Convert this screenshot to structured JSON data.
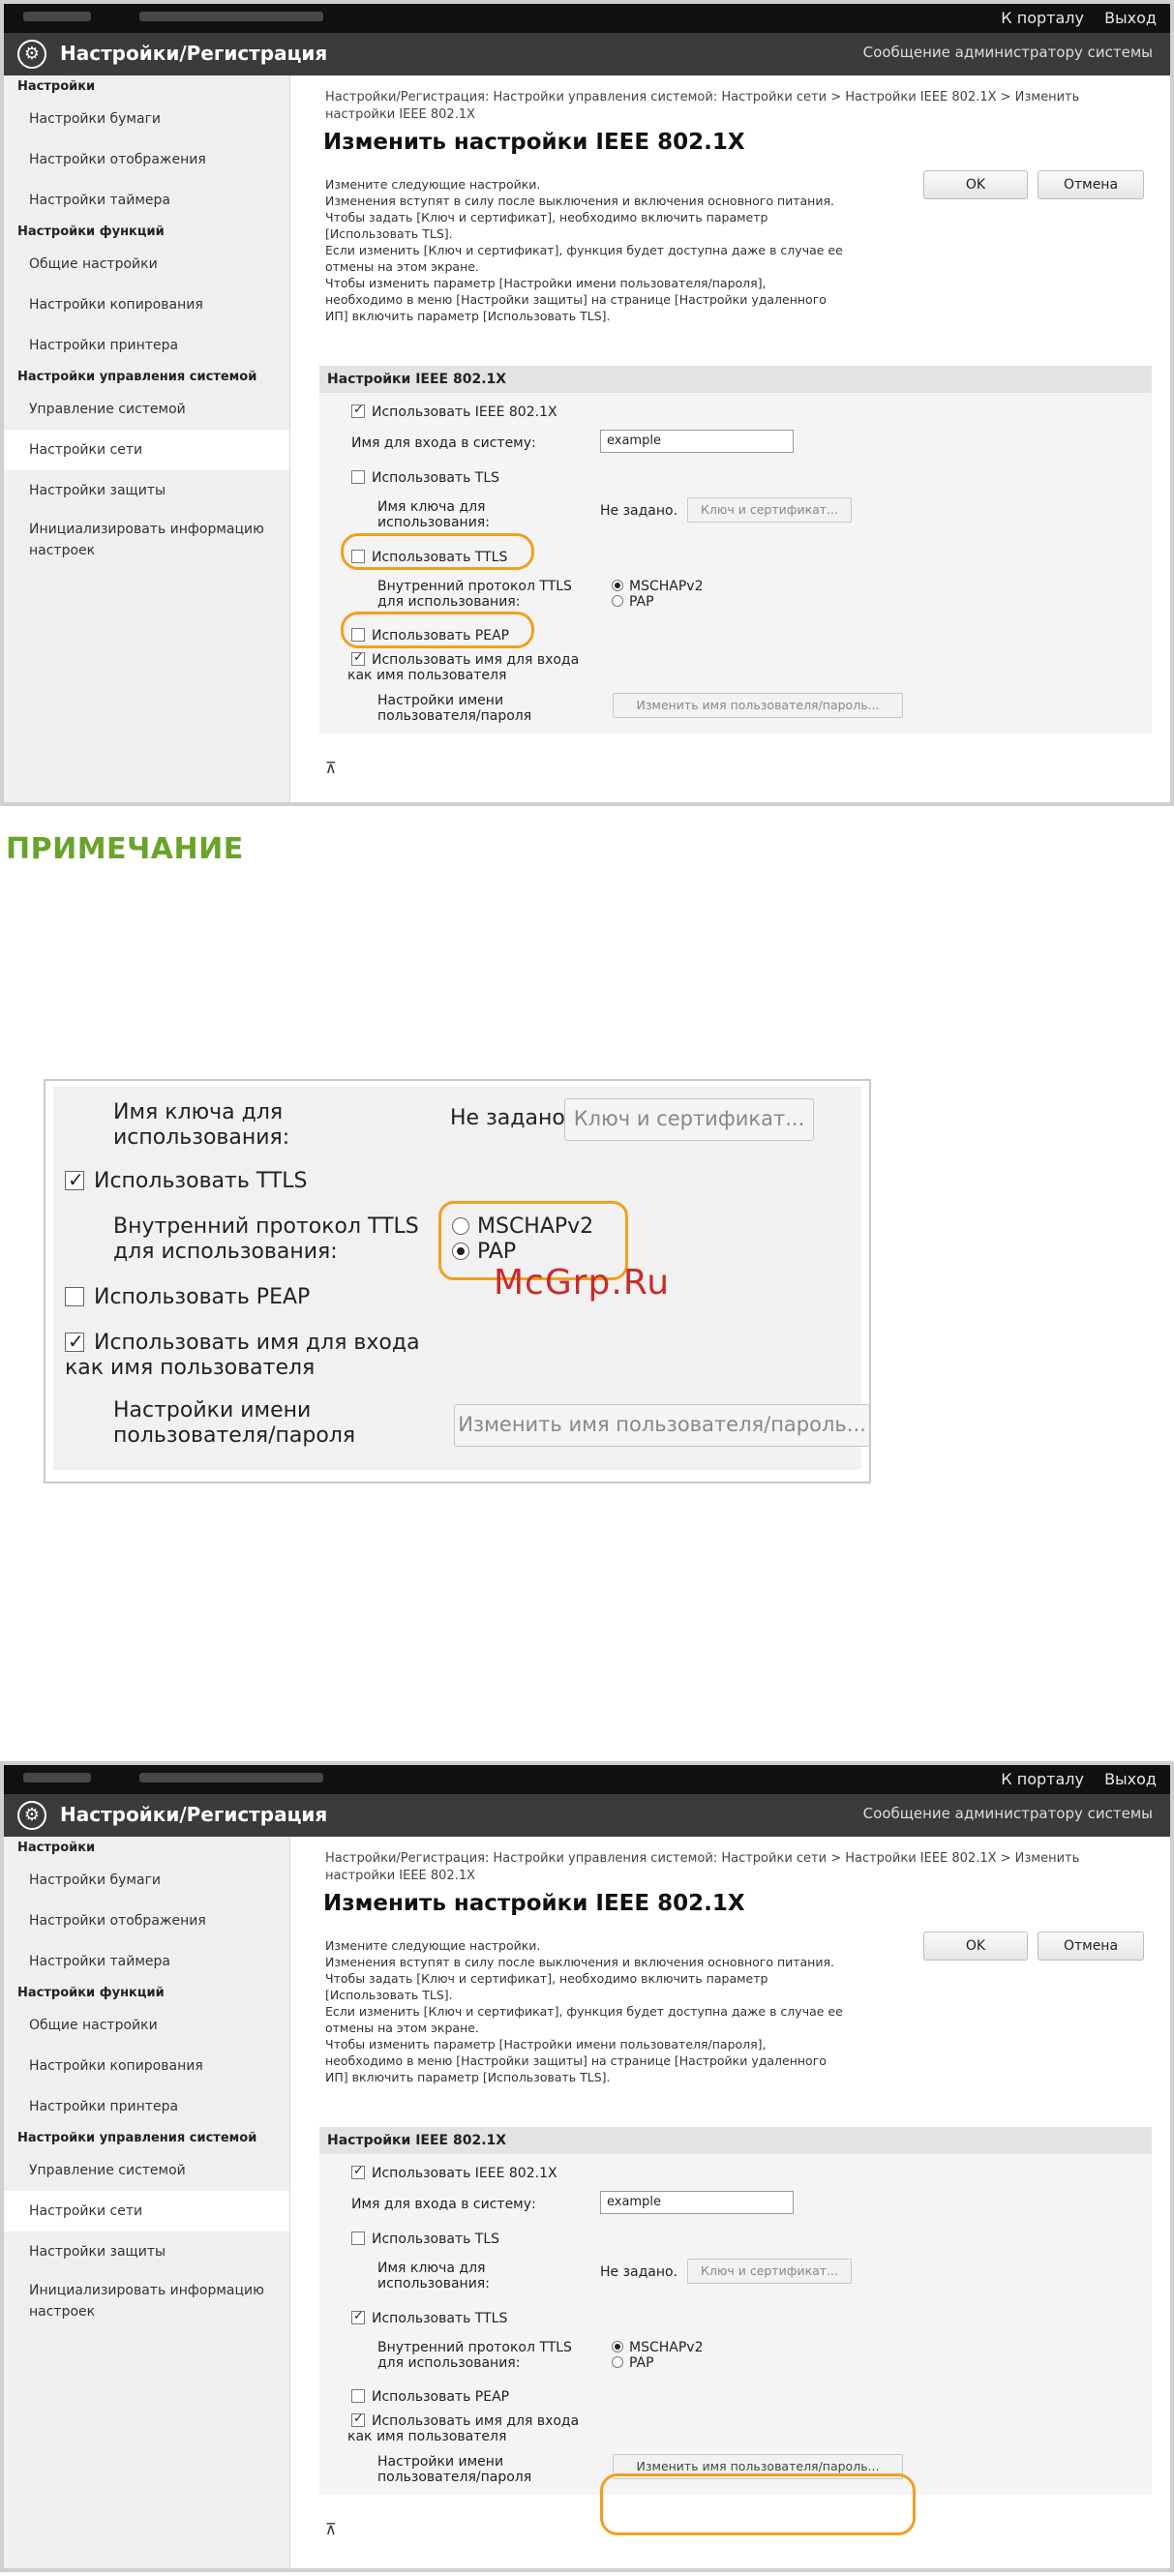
{
  "note_heading": "ПРИМЕЧАНИЕ",
  "watermark": "McGrp.Ru",
  "header": {
    "portal_link": "К порталу",
    "logout_link": "Выход",
    "app_title": "Настройки/Регистрация",
    "admin_message": "Сообщение администратору системы"
  },
  "sidebar": {
    "settings_cat": "Настройки",
    "paper": "Настройки бумаги",
    "display": "Настройки отображения",
    "timer": "Настройки таймера",
    "function_cat": "Настройки функций",
    "common": "Общие настройки",
    "copy": "Настройки копирования",
    "printer": "Настройки принтера",
    "sysmgmt_cat": "Настройки управления системой",
    "system_mgmt": "Управление системой",
    "network": "Настройки сети",
    "security": "Настройки защиты",
    "init_line1": "Инициализировать информацию",
    "init_line2": "настроек"
  },
  "main": {
    "breadcrumb_line1": "Настройки/Регистрация: Настройки управления системой: Настройки сети > Настройки IEEE 802.1X > Изменить",
    "breadcrumb_line2": "настройки IEEE 802.1X",
    "title": "Изменить настройки IEEE 802.1X",
    "ok_button": "OK",
    "cancel_button": "Отмена",
    "desc": [
      "Измените следующие настройки.",
      "Изменения вступят в силу после выключения и включения основного питания.",
      "Чтобы задать [Ключ и сертификат], необходимо включить параметр",
      "[Использовать TLS].",
      "Если изменить [Ключ и сертификат], функция будет доступна даже в случае ее",
      "отмены на этом экране.",
      "Чтобы изменить параметр [Настройки имени пользователя/пароля],",
      "необходимо в меню [Настройки защиты] на странице [Настройки удаленного",
      "ИП] включить параметр [Использовать TLS]."
    ],
    "section_title": "Настройки IEEE 802.1X",
    "use_ieee": "Использовать IEEE 802.1X",
    "login_name_label": "Имя для входа в систему:",
    "login_name_value": "example",
    "use_tls": "Использовать TLS",
    "key_label_1": "Имя ключа для",
    "key_label_2": "использования:",
    "key_status": "Не задано.",
    "key_button": "Ключ и сертификат...",
    "use_ttls": "Использовать TTLS",
    "inner_proto_1": "Внутренний протокол TTLS",
    "inner_proto_2": "для использования:",
    "mschap": "MSCHAPv2",
    "pap": "PAP",
    "use_peap": "Использовать PEAP",
    "use_login_as_user_1": "Использовать имя для входа",
    "use_login_as_user_2": "как имя пользователя",
    "user_settings_1": "Настройки имени",
    "user_settings_2": "пользователя/пароля",
    "change_user_button": "Изменить имя пользователя/пароль...",
    "to_top": "⊼"
  },
  "zoom": {
    "key_label_1": "Имя ключа для",
    "key_label_2": "использования:",
    "key_status": "Не задано.",
    "key_button": "Ключ и сертификат...",
    "use_ttls": "Использовать TTLS",
    "inner_proto_1": "Внутренний протокол TTLS",
    "inner_proto_2": "для использования:",
    "mschap": "MSCHAPv2",
    "pap": "PAP",
    "use_peap": "Использовать PEAP",
    "use_login_1": "Использовать имя для входа",
    "use_login_2": "как имя пользователя",
    "user_settings_1": "Настройки имени",
    "user_settings_2": "пользователя/пароля",
    "change_user_button": "Изменить имя пользователя/пароль..."
  },
  "colors": {
    "highlight": "#f0a020",
    "note_green": "#6aa32b",
    "titlebar": "#3b3b3b",
    "watermark": "#c92b2b"
  }
}
